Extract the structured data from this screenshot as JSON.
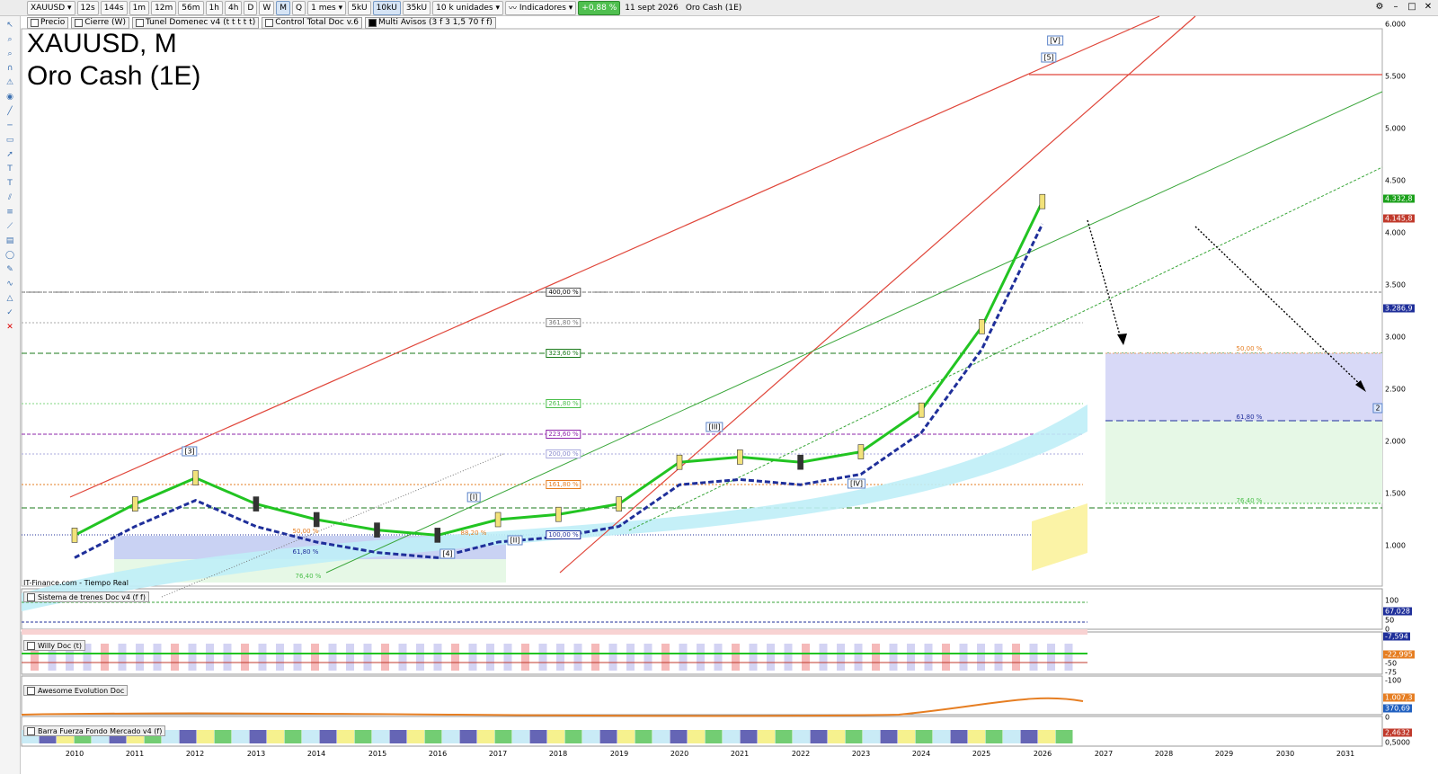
{
  "toolbar": {
    "symbol": "XAUUSD",
    "intervals": [
      "12s",
      "144s",
      "1m",
      "12m",
      "56m",
      "1h",
      "4h",
      "D",
      "W",
      "M",
      "Q"
    ],
    "range": "1 mes",
    "ticks": [
      "5kU",
      "10kU",
      "35kU"
    ],
    "units": "10 k unidades",
    "indicators": "Indicadores",
    "change": "+0,88 %",
    "date": "11 sept 2026",
    "instrument": "Oro Cash (1E)"
  },
  "indicators_bar": [
    "Precio",
    "Cierre (W)",
    "Tunel Domenec v4 (t t t t t)",
    "Control Total Doc v.6",
    "Multi Avisos (3 f 3 1,5 70 f f)"
  ],
  "chart_title": {
    "line1": "XAUUSD, M",
    "line2": "Oro Cash (1E)"
  },
  "source": "IT-Finance.com - Tiempo Real",
  "panels": [
    {
      "name": "Sistema de trenes Doc v4 (f f)"
    },
    {
      "name": "Willy Doc (t)"
    },
    {
      "name": "Awesome Evolution Doc"
    },
    {
      "name": "Barra Fuerza Fondo Mercado v4 (f)"
    }
  ],
  "price_axis": [
    "6.000",
    "5.500",
    "5.000",
    "4.500",
    "4.000",
    "3.500",
    "3.000",
    "2.500",
    "2.000",
    "1.500",
    "1.000"
  ],
  "price_tags": [
    {
      "text": "4.332,8",
      "color": "#1aa01a"
    },
    {
      "text": "4.145,8",
      "color": "#c0392b"
    },
    {
      "text": "3.286,9",
      "color": "#1f2f9a"
    }
  ],
  "sub_axis": {
    "trenes": [
      "100",
      "67,028",
      "50",
      "0",
      "-7,594"
    ],
    "willy": [
      "-22,995",
      "-50",
      "-75",
      "-100"
    ],
    "awesome": [
      "1.007,3",
      "370,69",
      "0"
    ],
    "barra": [
      "2,4632",
      "0,5000"
    ]
  },
  "years": [
    "2010",
    "2011",
    "2012",
    "2013",
    "2014",
    "2015",
    "2016",
    "2017",
    "2018",
    "2019",
    "2020",
    "2021",
    "2022",
    "2023",
    "2024",
    "2025",
    "2026",
    "2027",
    "2028",
    "2029",
    "2030",
    "2031"
  ],
  "waves": [
    "[3]",
    "[4]",
    "[I]",
    "[II]",
    "[III]",
    "[IV]",
    "[5]",
    "[V]",
    "2"
  ],
  "fib_levels": [
    "400,00 %",
    "361,80 %",
    "323,60 %",
    "261,80 %",
    "223,60 %",
    "200,00 %",
    "161,80 %",
    "100,00 %",
    "50,00 %",
    "61,80 %",
    "76,40 %",
    "88,20 %",
    "50,00 %",
    "61,80 %"
  ],
  "chart_data": {
    "type": "line",
    "title": "XAUUSD, M",
    "subtitle": "Oro Cash (1E)",
    "x": [
      2010,
      2011,
      2012,
      2013,
      2014,
      2015,
      2016,
      2017,
      2018,
      2019,
      2020,
      2021,
      2022,
      2023,
      2024,
      2025,
      2026
    ],
    "series": [
      {
        "values": [
          1100,
          1400,
          1650,
          1400,
          1250,
          1150,
          1100,
          1250,
          1300,
          1400,
          1800,
          1850,
          1800,
          1900,
          2300,
          3100,
          4300
        ]
      }
    ],
    "ylim": [
      900,
      6000
    ]
  }
}
